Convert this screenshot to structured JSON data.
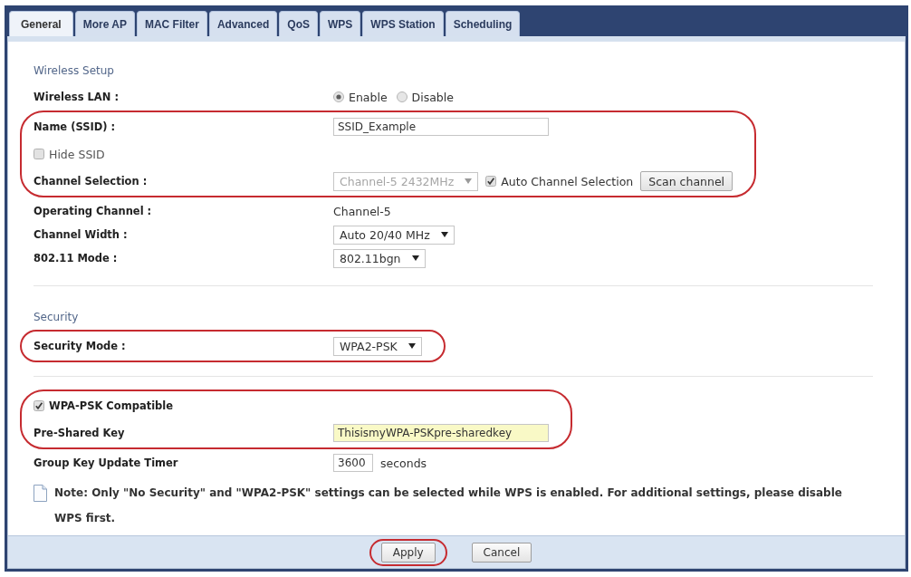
{
  "tabs": [
    {
      "label": "General",
      "selected": true
    },
    {
      "label": "More AP",
      "selected": false
    },
    {
      "label": "MAC Filter",
      "selected": false
    },
    {
      "label": "Advanced",
      "selected": false
    },
    {
      "label": "QoS",
      "selected": false
    },
    {
      "label": "WPS",
      "selected": false
    },
    {
      "label": "WPS Station",
      "selected": false
    },
    {
      "label": "Scheduling",
      "selected": false
    }
  ],
  "sections": [
    {
      "heading": "Wireless Setup",
      "groups": [
        {
          "highlighted": false,
          "rows": [
            {
              "kind": "field",
              "label": "Wireless LAN :",
              "controls": [
                {
                  "kind": "radio",
                  "options": [
                    {
                      "label": "Enable",
                      "selected": true
                    },
                    {
                      "label": "Disable",
                      "selected": false
                    }
                  ]
                }
              ]
            }
          ]
        },
        {
          "highlighted": true,
          "rows": [
            {
              "kind": "field",
              "label": "Name (SSID) :",
              "controls": [
                {
                  "kind": "text",
                  "value": "SSID_Example",
                  "autofilled": false
                }
              ]
            },
            {
              "kind": "option",
              "controls": [
                {
                  "kind": "checkbox",
                  "label": "Hide SSID",
                  "checked": false
                }
              ]
            },
            {
              "kind": "field",
              "label": "Channel Selection :",
              "controls": [
                {
                  "kind": "select",
                  "value": "Channel-5 2432MHz",
                  "disabled": true
                },
                {
                  "kind": "checkbox",
                  "label": "Auto Channel Selection",
                  "checked": true
                },
                {
                  "kind": "button",
                  "label": "Scan channel"
                }
              ]
            }
          ]
        },
        {
          "highlighted": false,
          "rows": [
            {
              "kind": "field",
              "label": "Operating Channel :",
              "controls": [
                {
                  "kind": "plain",
                  "value": "Channel-5"
                }
              ]
            },
            {
              "kind": "field",
              "label": "Channel Width :",
              "controls": [
                {
                  "kind": "select",
                  "value": "Auto 20/40 MHz",
                  "disabled": false
                }
              ]
            },
            {
              "kind": "field",
              "label": "802.11 Mode :",
              "controls": [
                {
                  "kind": "select",
                  "value": "802.11bgn",
                  "disabled": false
                }
              ]
            }
          ]
        }
      ]
    },
    {
      "heading": "Security",
      "groups": [
        {
          "highlighted": true,
          "rows": [
            {
              "kind": "field",
              "label": "Security Mode :",
              "controls": [
                {
                  "kind": "select",
                  "value": "WPA2-PSK",
                  "disabled": false
                }
              ]
            }
          ]
        }
      ]
    },
    {
      "groups": [
        {
          "highlighted": true,
          "rows": [
            {
              "kind": "flag",
              "controls": [
                {
                  "kind": "checkbox",
                  "label": "WPA-PSK Compatible",
                  "checked": true
                }
              ]
            },
            {
              "kind": "field",
              "label": "Pre-Shared Key",
              "controls": [
                {
                  "kind": "text",
                  "value": "ThisismyWPA-PSKpre-sharedkey",
                  "autofilled": true
                }
              ]
            }
          ]
        },
        {
          "highlighted": false,
          "rows": [
            {
              "kind": "field",
              "label": "Group Key Update Timer",
              "controls": [
                {
                  "kind": "number",
                  "value": "3600"
                },
                {
                  "kind": "unit",
                  "text": "seconds"
                }
              ]
            }
          ]
        }
      ]
    }
  ],
  "note": "Note: Only \"No Security\" and \"WPA2-PSK\" settings can be selected while WPS is enabled. For additional settings, please disable WPS first.",
  "buttons": [
    {
      "label": "Apply",
      "highlighted": true
    },
    {
      "label": "Cancel",
      "highlighted": false
    }
  ]
}
